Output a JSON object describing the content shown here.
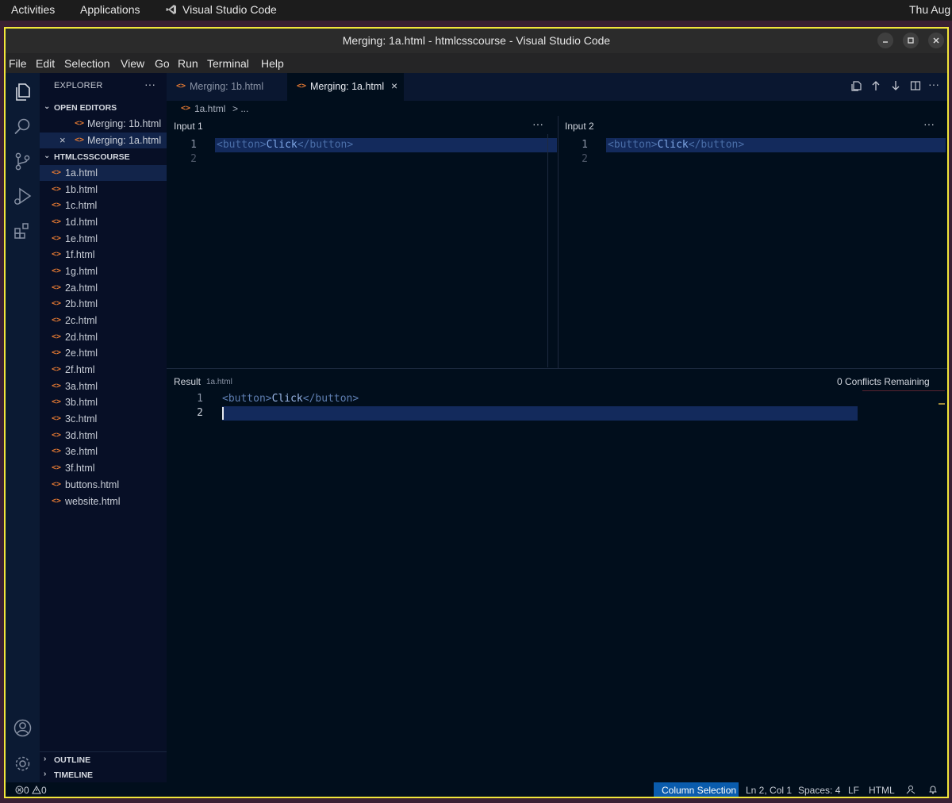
{
  "topbar": {
    "activities": "Activities",
    "applications": "Applications",
    "app_name": "Visual Studio Code",
    "clock": "Thu Aug"
  },
  "window": {
    "title": "Merging: 1a.html - htmlcsscourse - Visual Studio Code"
  },
  "menu": [
    "File",
    "Edit",
    "Selection",
    "View",
    "Go",
    "Run",
    "Terminal",
    "Help"
  ],
  "activity_bar": {
    "top_icons": [
      "explorer-icon",
      "search-icon",
      "source-control-icon",
      "run-debug-icon",
      "extensions-icon"
    ],
    "bottom_icons": [
      "account-icon",
      "settings-gear-icon"
    ]
  },
  "sidebar": {
    "header": "EXPLORER",
    "more": "···",
    "open_editors": {
      "label": "OPEN EDITORS",
      "items": [
        "Merging: 1b.html",
        "Merging: 1a.html"
      ]
    },
    "project": {
      "label": "HTMLCSSCOURSE",
      "files": [
        "1a.html",
        "1b.html",
        "1c.html",
        "1d.html",
        "1e.html",
        "1f.html",
        "1g.html",
        "2a.html",
        "2b.html",
        "2c.html",
        "2d.html",
        "2e.html",
        "2f.html",
        "3a.html",
        "3b.html",
        "3c.html",
        "3d.html",
        "3e.html",
        "3f.html",
        "buttons.html",
        "website.html"
      ]
    },
    "outline": "OUTLINE",
    "timeline": "TIMELINE"
  },
  "tabs": [
    {
      "label": "Merging: 1b.html",
      "active": false
    },
    {
      "label": "Merging: 1a.html",
      "active": true
    }
  ],
  "breadcrumb": {
    "file": "1a.html",
    "rest": "> ..."
  },
  "merge": {
    "input1": {
      "title": "Input 1",
      "more": "···",
      "lines": [
        "1",
        "2"
      ]
    },
    "input2": {
      "title": "Input 2",
      "more": "···",
      "lines": [
        "1",
        "2"
      ]
    },
    "code": {
      "open_tag": "<button>",
      "text": "Click",
      "close_tag": "</button>"
    },
    "result": {
      "title": "Result",
      "file": "1a.html",
      "conflicts": "0 Conflicts Remaining",
      "lines": [
        "1",
        "2"
      ]
    }
  },
  "statusbar": {
    "errors": "0",
    "warnings": "0",
    "column_selection": "Column Selection",
    "position": "Ln 2, Col 1",
    "spaces": "Spaces: 4",
    "eol": "LF",
    "language": "HTML"
  }
}
